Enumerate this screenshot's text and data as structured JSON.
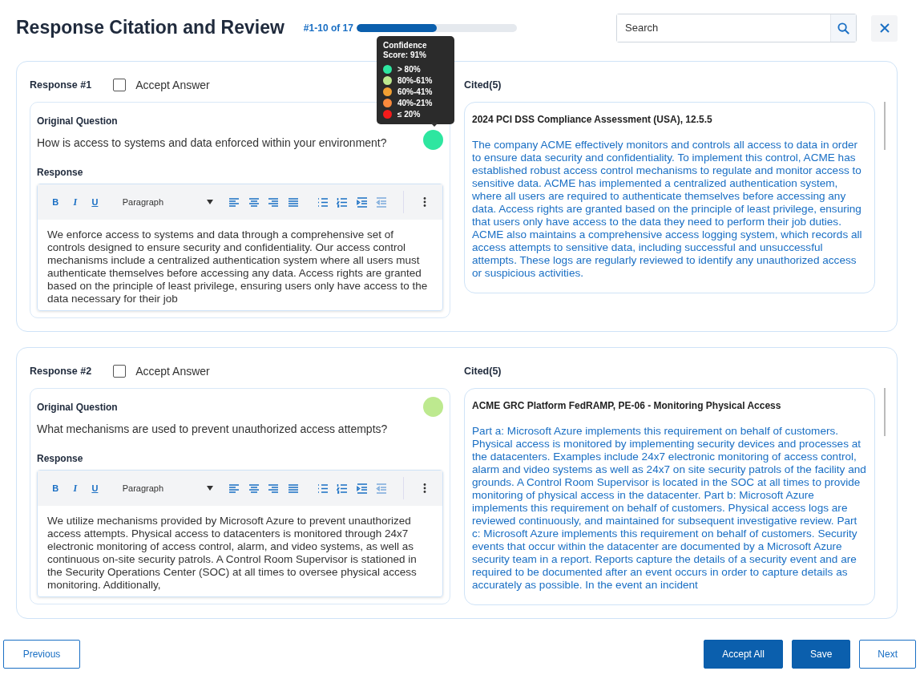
{
  "header": {
    "title": "Response Citation and Review",
    "progress": {
      "label": "#1-10 of 17",
      "level": 0.5
    },
    "search": {
      "placeholder": "Search"
    }
  },
  "tooltip": {
    "title": "Confidence Score: 91%",
    "legend": [
      {
        "label": "> 80%",
        "color": "#2ee6a0"
      },
      {
        "label": "80%-61%",
        "color": "#bde98f"
      },
      {
        "label": "60%-41%",
        "color": "#f2a033"
      },
      {
        "label": "40%-21%",
        "color": "#fb8a3c"
      },
      {
        "label": "≤ 20%",
        "color": "#f51b1b"
      }
    ]
  },
  "responses": [
    {
      "label": "Response #1",
      "accept_label": "Accept Answer",
      "accepted": false,
      "question_heading": "Original Question",
      "question": "How is access to systems and data enforced within your environment?",
      "color": "#2ee6a0",
      "response_heading": "Response",
      "toolbar_marks": [
        "B",
        "I",
        "U"
      ],
      "format_label": "Paragraph",
      "response_text": "We enforce access to systems and data through a comprehensive set of controls designed to ensure security and confidentiality. Our access control mechanisms include a centralized authentication system where all users must authenticate themselves before accessing any data. Access rights are granted based on the principle of least privilege, ensuring users only have access to the data necessary for their job",
      "cited_label": "Cited(5)",
      "citations": [
        {
          "title": "2024 PCI DSS Compliance Assessment (USA), 12.5.5",
          "text": "The company ACME effectively monitors and controls all access to data in order to ensure data security and confidentiality. To implement this control, ACME has established robust access control mechanisms to regulate and monitor access to sensitive data. ACME has implemented a centralized authentication system, where all users are required to authenticate themselves before accessing any data. Access rights are granted based on the principle of least privilege, ensuring that users only have access to the data they need to perform their job duties. ACME also maintains a comprehensive access logging system, which records all access attempts to sensitive data, including successful and unsuccessful attempts. These logs are regularly reviewed to identify any unauthorized access or suspicious activities."
        }
      ]
    },
    {
      "label": "Response #2",
      "accept_label": "Accept Answer",
      "accepted": false,
      "question_heading": "Original Question",
      "question": "What mechanisms are used to prevent unauthorized access attempts?",
      "color": "#bde98f",
      "response_heading": "Response",
      "toolbar_marks": [
        "B",
        "I",
        "U"
      ],
      "format_label": "Paragraph",
      "response_text": "We utilize mechanisms provided by Microsoft Azure to prevent unauthorized access attempts. Physical access to datacenters is monitored through 24x7 electronic monitoring of access control, alarm, and video systems, as well as continuous on-site security patrols. A Control Room Supervisor is stationed in the Security Operations Center (SOC) at all times to oversee physical access monitoring. Additionally,",
      "cited_label": "Cited(5)",
      "citations": [
        {
          "title": "ACME GRC Platform FedRAMP, PE-06 - Monitoring Physical Access",
          "text": "Part a: Microsoft Azure implements this requirement on behalf of customers. Physical access is monitored by implementing security devices and processes at the datacenters. Examples include 24x7 electronic monitoring of access control, alarm and video systems as well as 24x7 on site security patrols of the facility and grounds. A Control Room Supervisor is located in the SOC at all times to provide monitoring of physical access in the datacenter. Part b: Microsoft Azure implements this requirement on behalf of customers. Physical access logs are reviewed continuously, and maintained for subsequent investigative review. Part c: Microsoft Azure implements this requirement on behalf of customers. Security events that occur within the datacenter are documented by a Microsoft Azure security team in a report. Reports capture the details of a security event and are required to be documented after an event occurs in order to capture details as accurately as possible. In the event an incident"
        }
      ]
    }
  ],
  "footer": {
    "left": [
      {
        "label": "Previous",
        "kind": "outline"
      }
    ],
    "right": [
      {
        "label": "Accept All",
        "kind": "primary"
      },
      {
        "label": "Save",
        "kind": "primary"
      },
      {
        "label": "Next",
        "kind": "outline"
      }
    ]
  }
}
